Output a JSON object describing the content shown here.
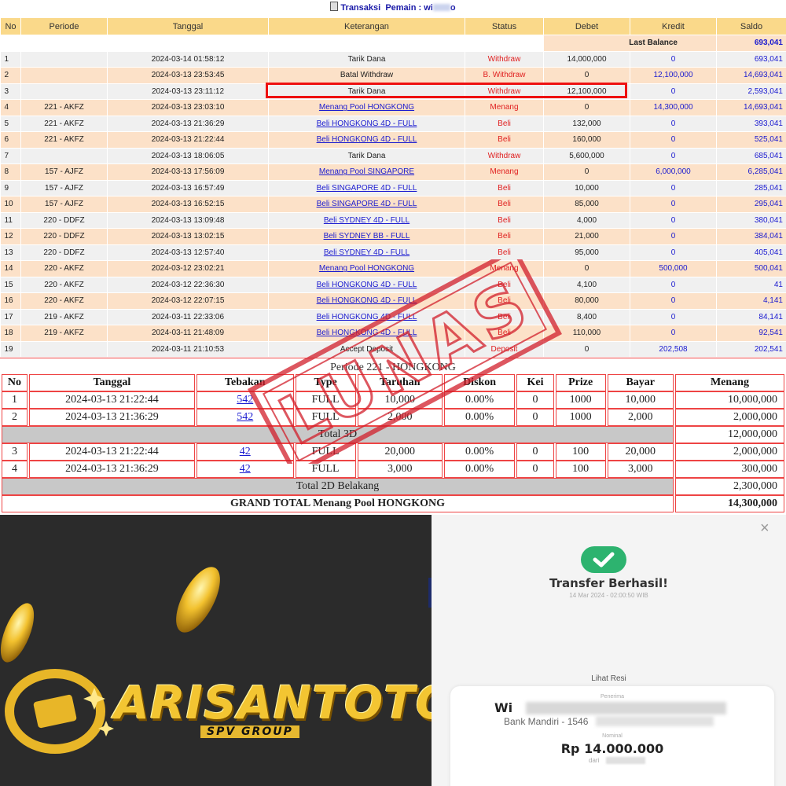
{
  "transactions": {
    "title_prefix": "Transaksi",
    "title_user": "Pemain : wi",
    "title_user_tail": "o",
    "columns": [
      "No",
      "Periode",
      "Tanggal",
      "Keterangan",
      "Status",
      "Debet",
      "Kredit",
      "Saldo"
    ],
    "last_balance_label": "Last Balance",
    "last_balance_value": "693,041",
    "rows": [
      {
        "no": "1",
        "periode": "",
        "tanggal": "2024-03-14 01:58:12",
        "ket": "Tarik Dana",
        "link": false,
        "status": "Withdraw",
        "debet": "14,000,000",
        "kredit": "0",
        "saldo": "693,041"
      },
      {
        "no": "2",
        "periode": "",
        "tanggal": "2024-03-13 23:53:45",
        "ket": "Batal Withdraw",
        "link": false,
        "status": "B. Withdraw",
        "debet": "0",
        "kredit": "12,100,000",
        "saldo": "14,693,041"
      },
      {
        "no": "3",
        "periode": "",
        "tanggal": "2024-03-13 23:11:12",
        "ket": "Tarik Dana",
        "link": false,
        "status": "Withdraw",
        "debet": "12,100,000",
        "kredit": "0",
        "saldo": "2,593,041"
      },
      {
        "no": "4",
        "periode": "221 - AKFZ",
        "tanggal": "2024-03-13 23:03:10",
        "ket": "Menang Pool HONGKONG",
        "link": true,
        "status": "Menang",
        "debet": "0",
        "kredit": "14,300,000",
        "saldo": "14,693,041"
      },
      {
        "no": "5",
        "periode": "221 - AKFZ",
        "tanggal": "2024-03-13 21:36:29",
        "ket": "Beli HONGKONG 4D - FULL",
        "link": true,
        "status": "Beli",
        "debet": "132,000",
        "kredit": "0",
        "saldo": "393,041"
      },
      {
        "no": "6",
        "periode": "221 - AKFZ",
        "tanggal": "2024-03-13 21:22:44",
        "ket": "Beli HONGKONG 4D - FULL",
        "link": true,
        "status": "Beli",
        "debet": "160,000",
        "kredit": "0",
        "saldo": "525,041"
      },
      {
        "no": "7",
        "periode": "",
        "tanggal": "2024-03-13 18:06:05",
        "ket": "Tarik Dana",
        "link": false,
        "status": "Withdraw",
        "debet": "5,600,000",
        "kredit": "0",
        "saldo": "685,041"
      },
      {
        "no": "8",
        "periode": "157 - AJFZ",
        "tanggal": "2024-03-13 17:56:09",
        "ket": "Menang Pool SINGAPORE",
        "link": true,
        "status": "Menang",
        "debet": "0",
        "kredit": "6,000,000",
        "saldo": "6,285,041"
      },
      {
        "no": "9",
        "periode": "157 - AJFZ",
        "tanggal": "2024-03-13 16:57:49",
        "ket": "Beli SINGAPORE 4D - FULL",
        "link": true,
        "status": "Beli",
        "debet": "10,000",
        "kredit": "0",
        "saldo": "285,041"
      },
      {
        "no": "10",
        "periode": "157 - AJFZ",
        "tanggal": "2024-03-13 16:52:15",
        "ket": "Beli SINGAPORE 4D - FULL",
        "link": true,
        "status": "Beli",
        "debet": "85,000",
        "kredit": "0",
        "saldo": "295,041"
      },
      {
        "no": "11",
        "periode": "220 - DDFZ",
        "tanggal": "2024-03-13 13:09:48",
        "ket": "Beli SYDNEY 4D - FULL",
        "link": true,
        "status": "Beli",
        "debet": "4,000",
        "kredit": "0",
        "saldo": "380,041"
      },
      {
        "no": "12",
        "periode": "220 - DDFZ",
        "tanggal": "2024-03-13 13:02:15",
        "ket": "Beli SYDNEY BB - FULL",
        "link": true,
        "status": "Beli",
        "debet": "21,000",
        "kredit": "0",
        "saldo": "384,041"
      },
      {
        "no": "13",
        "periode": "220 - DDFZ",
        "tanggal": "2024-03-13 12:57:40",
        "ket": "Beli SYDNEY 4D - FULL",
        "link": true,
        "status": "Beli",
        "debet": "95,000",
        "kredit": "0",
        "saldo": "405,041"
      },
      {
        "no": "14",
        "periode": "220 - AKFZ",
        "tanggal": "2024-03-12 23:02:21",
        "ket": "Menang Pool HONGKONG",
        "link": true,
        "status": "Menang",
        "debet": "0",
        "kredit": "500,000",
        "saldo": "500,041"
      },
      {
        "no": "15",
        "periode": "220 - AKFZ",
        "tanggal": "2024-03-12 22:36:30",
        "ket": "Beli HONGKONG 4D - FULL",
        "link": true,
        "status": "Beli",
        "debet": "4,100",
        "kredit": "0",
        "saldo": "41"
      },
      {
        "no": "16",
        "periode": "220 - AKFZ",
        "tanggal": "2024-03-12 22:07:15",
        "ket": "Beli HONGKONG 4D - FULL",
        "link": true,
        "status": "Beli",
        "debet": "80,000",
        "kredit": "0",
        "saldo": "4,141"
      },
      {
        "no": "17",
        "periode": "219 - AKFZ",
        "tanggal": "2024-03-11 22:33:06",
        "ket": "Beli HONGKONG 4D - FULL",
        "link": true,
        "status": "Beli",
        "debet": "8,400",
        "kredit": "0",
        "saldo": "84,141"
      },
      {
        "no": "18",
        "periode": "219 - AKFZ",
        "tanggal": "2024-03-11 21:48:09",
        "ket": "Beli HONGKONG 4D - FULL",
        "link": true,
        "status": "Beli",
        "debet": "110,000",
        "kredit": "0",
        "saldo": "92,541"
      },
      {
        "no": "19",
        "periode": "",
        "tanggal": "2024-03-11 21:10:53",
        "ket": "Accept Deposit",
        "link": false,
        "status": "Deposit",
        "debet": "0",
        "kredit": "202,508",
        "saldo": "202,541"
      }
    ]
  },
  "detail": {
    "title": "Periode 221 - HONGKONG",
    "columns": [
      "No",
      "Tanggal",
      "Tebakan",
      "Type",
      "Taruhan",
      "Diskon",
      "Kei",
      "Prize",
      "Bayar",
      "Menang"
    ],
    "rows_3d": [
      {
        "no": "1",
        "tanggal": "2024-03-13 21:22:44",
        "tebakan": "542",
        "type": "FULL",
        "taruhan": "10,000",
        "diskon": "0.00%",
        "kei": "0",
        "prize": "1000",
        "bayar": "10,000",
        "menang": "10,000,000"
      },
      {
        "no": "2",
        "tanggal": "2024-03-13 21:36:29",
        "tebakan": "542",
        "type": "FULL",
        "taruhan": "2,000",
        "diskon": "0.00%",
        "kei": "0",
        "prize": "1000",
        "bayar": "2,000",
        "menang": "2,000,000"
      }
    ],
    "total_3d_label": "Total 3D",
    "total_3d_value": "12,000,000",
    "rows_2d": [
      {
        "no": "3",
        "tanggal": "2024-03-13 21:22:44",
        "tebakan": "42",
        "type": "FULL",
        "taruhan": "20,000",
        "diskon": "0.00%",
        "kei": "0",
        "prize": "100",
        "bayar": "20,000",
        "menang": "2,000,000"
      },
      {
        "no": "4",
        "tanggal": "2024-03-13 21:36:29",
        "tebakan": "42",
        "type": "FULL",
        "taruhan": "3,000",
        "diskon": "0.00%",
        "kei": "0",
        "prize": "100",
        "bayar": "3,000",
        "menang": "300,000"
      }
    ],
    "total_2d_label": "Total 2D Belakang",
    "total_2d_value": "2,300,000",
    "grand_label": "GRAND TOTAL  Menang Pool HONGKONG",
    "grand_value": "14,300,000",
    "stamp_text": "LUNAS"
  },
  "brand": {
    "logo_text": "ARISANTOTO",
    "sub_text": "SPV GROUP",
    "gold": "#f3c532"
  },
  "receipt": {
    "close": "×",
    "title": "Transfer Berhasil!",
    "date": "14 Mar 2024 - 02:00:50 WIB",
    "link": "Lihat Resi",
    "beneficiary_label": "Penerima",
    "name": "Wi",
    "bank": "Bank Mandiri - 1546",
    "nominal_label": "Nominal",
    "amount": "Rp 14.000.000",
    "from": "dari",
    "accent": "#2db36f"
  }
}
